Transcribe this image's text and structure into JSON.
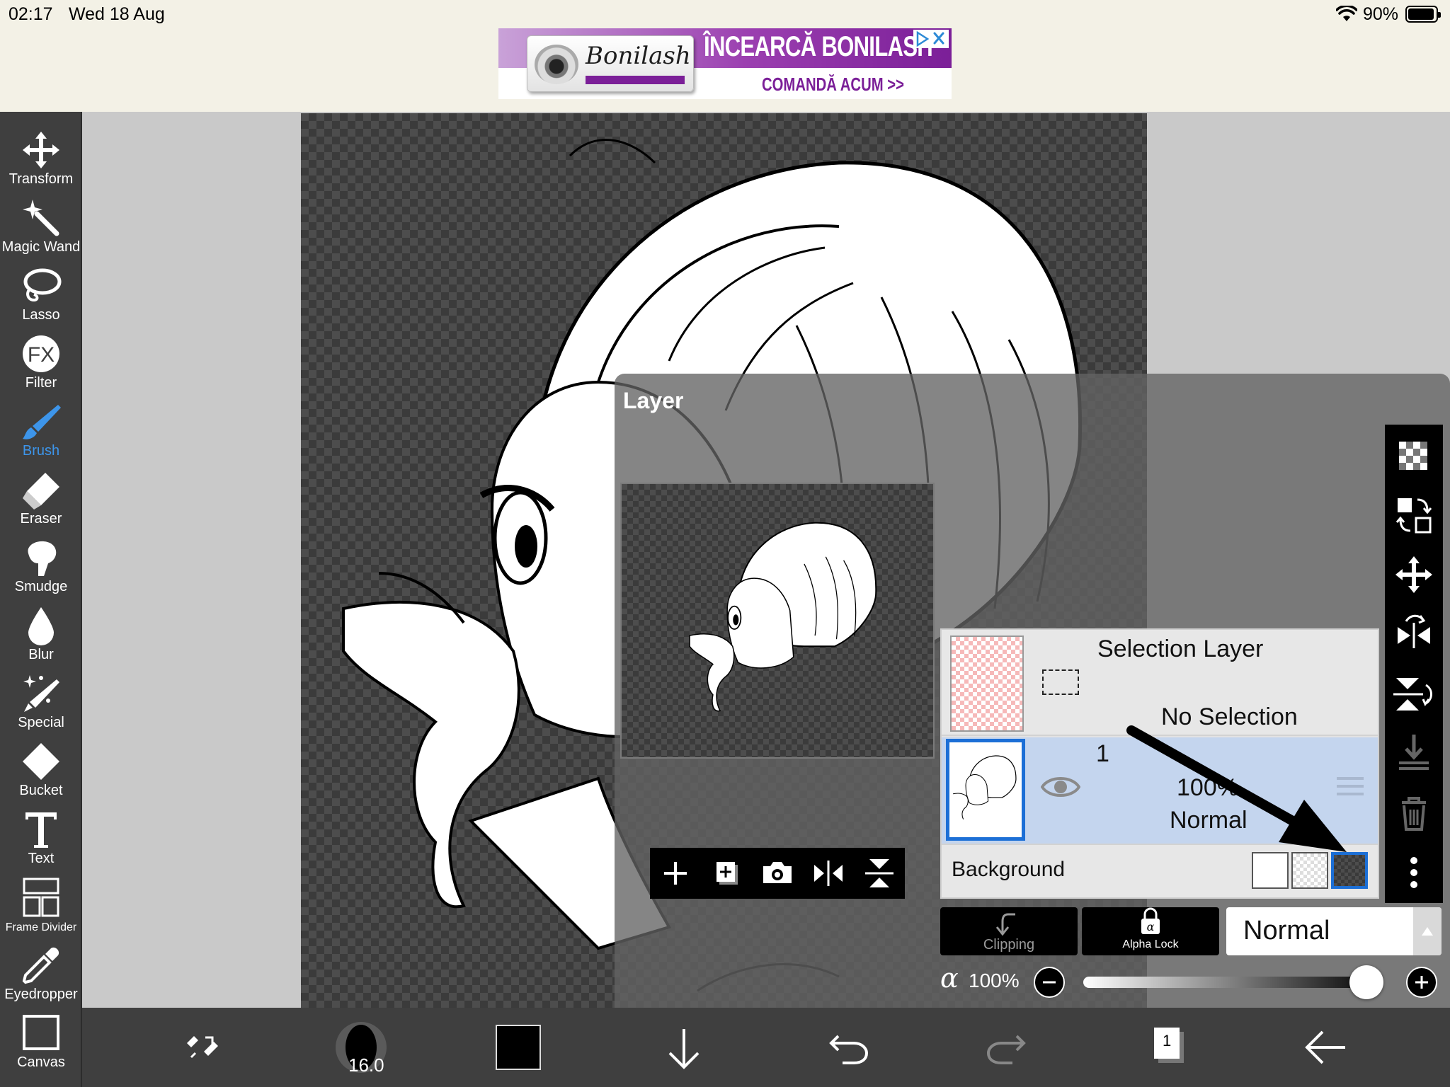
{
  "status_bar": {
    "time": "02:17",
    "date": "Wed 18 Aug",
    "battery": "90%"
  },
  "ad": {
    "brand": "Bonilash",
    "headline": "ÎNCEARCĂ BONILASH",
    "cta": "COMANDĂ ACUM >>"
  },
  "tools": [
    {
      "label": "Transform",
      "icon": "move-arrows-icon"
    },
    {
      "label": "Magic Wand",
      "icon": "magic-wand-icon"
    },
    {
      "label": "Lasso",
      "icon": "lasso-icon"
    },
    {
      "label": "Filter",
      "icon": "fx-icon"
    },
    {
      "label": "Brush",
      "icon": "brush-icon",
      "active": true
    },
    {
      "label": "Eraser",
      "icon": "eraser-icon"
    },
    {
      "label": "Smudge",
      "icon": "smudge-icon"
    },
    {
      "label": "Blur",
      "icon": "droplet-icon"
    },
    {
      "label": "Special",
      "icon": "sparkle-pen-icon"
    },
    {
      "label": "Bucket",
      "icon": "bucket-icon"
    },
    {
      "label": "Text",
      "icon": "text-t-icon"
    },
    {
      "label": "Frame Divider",
      "icon": "frame-divider-icon"
    },
    {
      "label": "Eyedropper",
      "icon": "eyedropper-icon"
    },
    {
      "label": "Canvas",
      "icon": "canvas-icon"
    }
  ],
  "bottom_bar": {
    "brush_size": "16.0",
    "color": "#000000",
    "layer_count": "1"
  },
  "layer_panel": {
    "title": "Layer",
    "selection_layer": {
      "name": "Selection Layer",
      "status": "No Selection"
    },
    "layer1": {
      "name": "1",
      "opacity": "100%",
      "blend": "Normal",
      "visible": true
    },
    "background": {
      "label": "Background",
      "selected_swatch": "dark-checker"
    },
    "clipping_label": "Clipping",
    "alpha_lock_label": "Alpha Lock",
    "blend_mode": "Normal",
    "opacity": {
      "symbol": "α",
      "value": "100%",
      "level": 1.0
    }
  },
  "colors": {
    "accent": "#3d95ea",
    "selected_border": "#1c6fd6",
    "toolbar": "#3f3f3f"
  }
}
